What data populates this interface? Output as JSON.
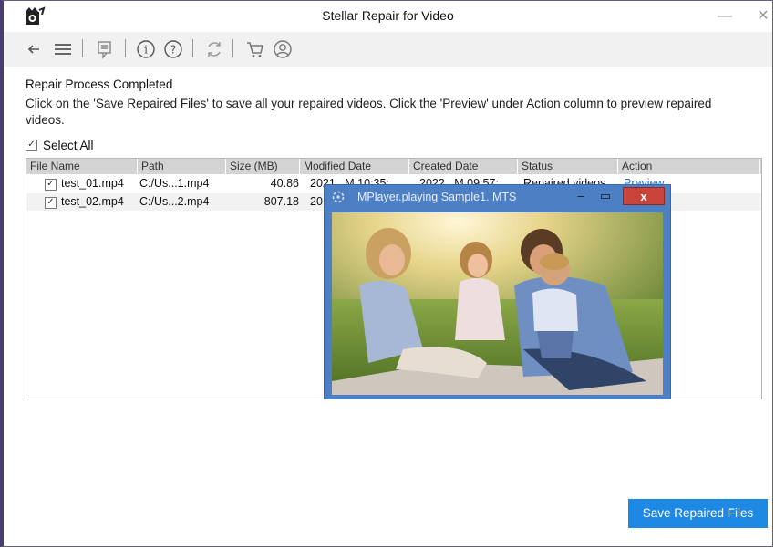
{
  "window": {
    "title": "Stellar Repair for Video",
    "minimize": "—",
    "close": "✕"
  },
  "toolbar": {
    "icons": [
      "back-arrow-icon",
      "hamburger-menu-icon",
      "feedback-icon",
      "info-icon",
      "help-icon",
      "update-icon",
      "cart-icon",
      "account-icon"
    ]
  },
  "main": {
    "heading": "Repair Process Completed",
    "description": "Click on the 'Save Repaired Files' to save all your repaired videos. Click the 'Preview' under Action column to preview repaired videos.",
    "select_all": "Select All"
  },
  "table": {
    "columns": [
      "File Name",
      "Path",
      "Size (MB)",
      "Modified Date",
      "Created Date",
      "Status",
      "Action"
    ],
    "rows": [
      {
        "name": "test_01.mp4",
        "path": "C:/Us...1.mp4",
        "size": "40.86",
        "modified": "2021...M 10:35:...",
        "created": "2022...M 09:57:...",
        "status": "Repaired videos",
        "action": "Preview"
      },
      {
        "name": "test_02.mp4",
        "path": "C:/Us...2.mp4",
        "size": "807.18",
        "modified": "20"
      }
    ]
  },
  "player": {
    "title": "MPlayer.playing Sample1. MTS",
    "minimize": "–",
    "maximize": "▭",
    "close": "x"
  },
  "footer": {
    "save_label": "Save Repaired Files"
  },
  "colors": {
    "accent": "#1e88e5",
    "player_frame": "#4d7fc4",
    "player_close": "#c9453b",
    "header_bg": "#d4d4d4",
    "toolbar_bg": "#f1f1f1"
  }
}
